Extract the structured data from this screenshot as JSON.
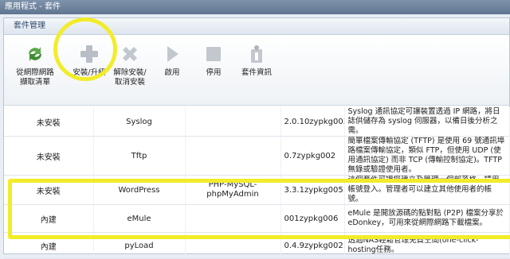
{
  "window": {
    "title": "應用程式 - 套件"
  },
  "panel": {
    "title": "套件管理"
  },
  "toolbar": {
    "buttons": [
      {
        "label": "從網際網路\n擷取清單",
        "icon": "refresh-icon"
      },
      {
        "label": "安裝/升級",
        "icon": "plus-icon"
      },
      {
        "label": "解除安裝/\n取消安裝",
        "icon": "cross-icon"
      },
      {
        "label": "啟用",
        "icon": "play-icon"
      },
      {
        "label": "停用",
        "icon": "stop-icon"
      },
      {
        "label": "套件資訊",
        "icon": "info-icon"
      }
    ]
  },
  "packages": [
    {
      "status": "未安裝",
      "name": "Syslog",
      "dependency": "",
      "version": "2.0.10zypkg003",
      "description": "Syslog 通訊協定可讓裝置透過 IP 網路，將日誌供儲存為 syslog 伺服器，以備日後分析之需。"
    },
    {
      "status": "未安裝",
      "name": "Tftp",
      "dependency": "",
      "version": "0.7zypkg002",
      "description": "簡單檔案傳輸協定 (TFTP) 是使用 69 號通訊埠路檔案傳輸協定，類似 FTP，但使用 UDP (使用通訊協定) 而非 TCP (傳輸控制協定)。TFTP 無錄或驗證使用者。"
    },
    {
      "status": "未安裝",
      "name": "WordPress",
      "dependency": "PHP-MySQL-\nphpMyAdmin",
      "version": "3.3.1zypkg005",
      "description": "這個套件可讓您建立及管理一個部落格。請用帳號登入。管理者可以建立其他使用者的帳號。"
    },
    {
      "status": "內建",
      "name": "eMule",
      "dependency": "",
      "version": "001zypkg006",
      "description": "eMule 是開放源碼的點對點 (P2P) 檔案分享於 eDonkey，可用來從網際網路下載檔案。"
    },
    {
      "status": "內建",
      "name": "pyLoad",
      "dependency": "",
      "version": "0.4.9zypkg002",
      "description": "透過NAS輕鬆管理免費空間(one-click-hosting任務。"
    }
  ],
  "colors": {
    "highlight": "#f2ec2a",
    "titlebar": "#6b819c"
  }
}
